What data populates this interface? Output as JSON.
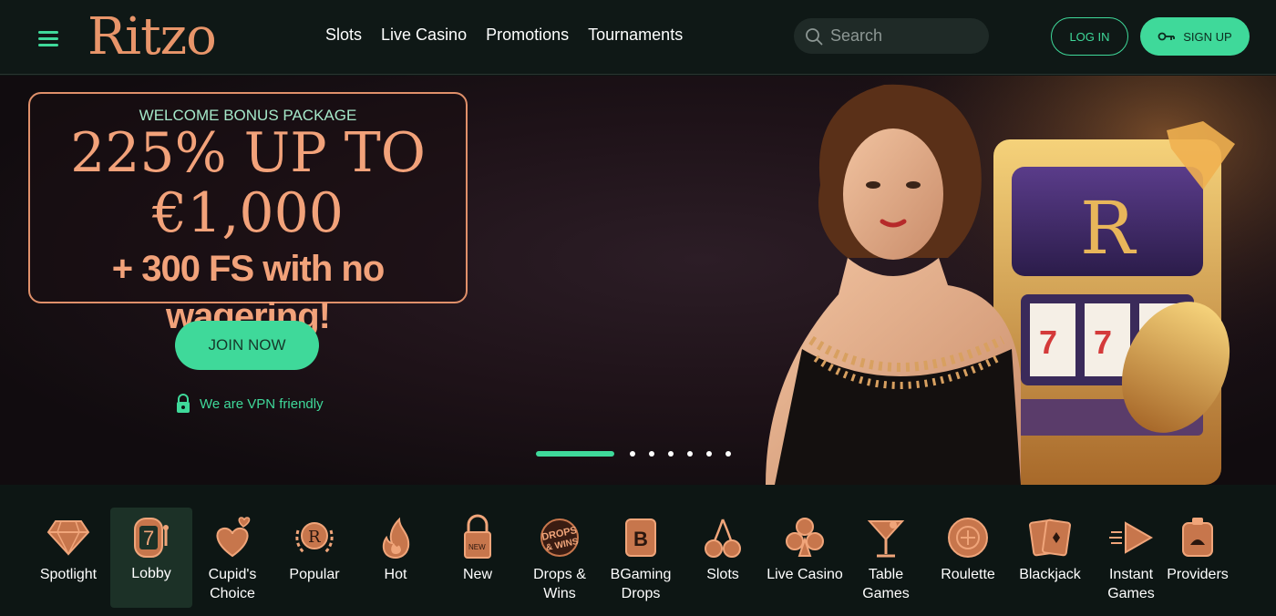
{
  "header": {
    "logo": "Ritzo",
    "nav": [
      "Slots",
      "Live Casino",
      "Promotions",
      "Tournaments"
    ],
    "search_placeholder": "Search",
    "login_label": "LOG IN",
    "signup_label": "SIGN UP"
  },
  "hero": {
    "subtitle": "WELCOME BONUS PACKAGE",
    "line1": "225% UP TO",
    "line2": "€1,000",
    "line3": "+ 300 FS with no wagering!",
    "cta": "JOIN NOW",
    "vpn_text": "We are VPN friendly",
    "slider_total": 7,
    "slider_active": 1,
    "machine_letter": "R"
  },
  "categories": [
    {
      "label": "Spotlight",
      "icon": "diamond-icon"
    },
    {
      "label": "Lobby",
      "icon": "slot-seven-icon",
      "active": true
    },
    {
      "label": "Cupid's Choice",
      "icon": "hearts-icon"
    },
    {
      "label": "Popular",
      "icon": "laurel-r-icon"
    },
    {
      "label": "Hot",
      "icon": "flame-icon"
    },
    {
      "label": "New",
      "icon": "new-tag-icon"
    },
    {
      "label": "Drops & Wins",
      "icon": "drops-wins-icon"
    },
    {
      "label": "BGaming Drops",
      "icon": "bgaming-icon"
    },
    {
      "label": "Slots",
      "icon": "cherries-icon"
    },
    {
      "label": "Live Casino",
      "icon": "club-icon"
    },
    {
      "label": "Table Games",
      "icon": "cocktail-icon"
    },
    {
      "label": "Roulette",
      "icon": "roulette-icon"
    },
    {
      "label": "Blackjack",
      "icon": "cards-icon"
    },
    {
      "label": "Instant Games",
      "icon": "arrow-icon"
    },
    {
      "label": "Providers",
      "icon": "providers-icon"
    }
  ],
  "category_icon_text": {
    "new": "NEW",
    "drops_top": "DROPS",
    "drops_bottom": "& WINS",
    "bgaming": "B",
    "lobby": "7",
    "popular": "R"
  },
  "colors": {
    "accent": "#3fd99a",
    "gold": "#e8956a",
    "bg": "#0d1614"
  }
}
